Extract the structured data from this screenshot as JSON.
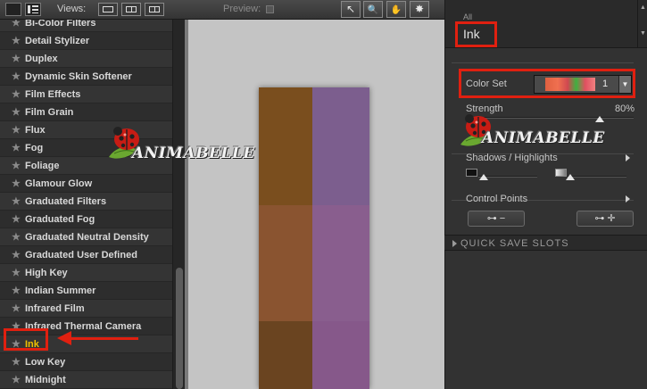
{
  "toolbar": {
    "views_label": "Views:",
    "preview_label": "Preview:",
    "tools": [
      "↖",
      "🔍",
      "✋",
      "✸"
    ]
  },
  "filters": {
    "items": [
      "Bi-Color Filters",
      "Detail Stylizer",
      "Duplex",
      "Dynamic Skin Softener",
      "Film Effects",
      "Film Grain",
      "Flux",
      "Fog",
      "Foliage",
      "Glamour Glow",
      "Graduated Filters",
      "Graduated Fog",
      "Graduated Neutral Density",
      "Graduated User Defined",
      "High Key",
      "Indian Summer",
      "Infrared Film",
      "Infrared Thermal Camera",
      "Ink",
      "Low Key",
      "Midnight"
    ],
    "selected": "Ink",
    "scroll_fraction": 0.67
  },
  "preview": {
    "swatch_colors": [
      "#7a4e1e",
      "#7c5e8e",
      "#8a5430",
      "#895e8e",
      "#6a4420",
      "#86588a"
    ]
  },
  "panel": {
    "category": "All",
    "filter_name": "Ink",
    "color_set_label": "Color Set",
    "color_set_value": "1",
    "strength_label": "Strength",
    "strength_value": "80%",
    "strength_level": 0.8,
    "shadows_highlights_label": "Shadows / Highlights",
    "control_points_label": "Control Points",
    "quick_save_label": "QUICK SAVE SLOTS"
  },
  "watermark": {
    "text": "ANIMABELLE"
  },
  "colors": {
    "annotation_red": "#e02010",
    "selected_text": "#f0c000"
  }
}
